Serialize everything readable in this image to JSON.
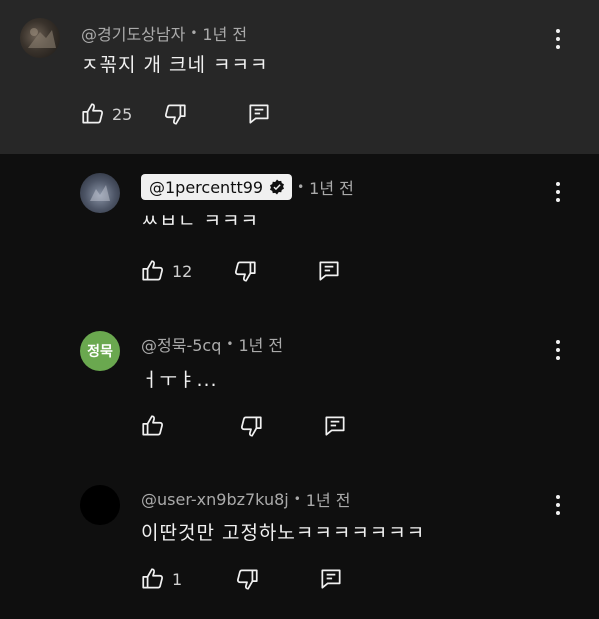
{
  "comments": [
    {
      "handle": "@경기도상남자",
      "time": "1년 전",
      "text": "ㅈ꼮지 개 크네 ㅋㅋㅋ",
      "likes": "25",
      "avatar_text": ""
    },
    {
      "handle": "@1percentt99",
      "time": "1년 전",
      "text": "ㅆㅂㄴ ㅋㅋㅋ",
      "likes": "12",
      "avatar_text": ""
    },
    {
      "handle": "@정묵-5cq",
      "time": "1년 전",
      "text": "ㅓㅜㅑ...",
      "likes": "",
      "avatar_text": "정묵"
    },
    {
      "handle": "@user-xn9bz7ku8j",
      "time": "1년 전",
      "text": "이딴것만 고정하노ㅋㅋㅋㅋㅋㅋㅋ",
      "likes": "1",
      "avatar_text": ""
    }
  ],
  "separator": "•",
  "colors": {
    "top_background": "#272727",
    "background": "#0f0f0f",
    "avatar_green": "#6aa84f"
  }
}
